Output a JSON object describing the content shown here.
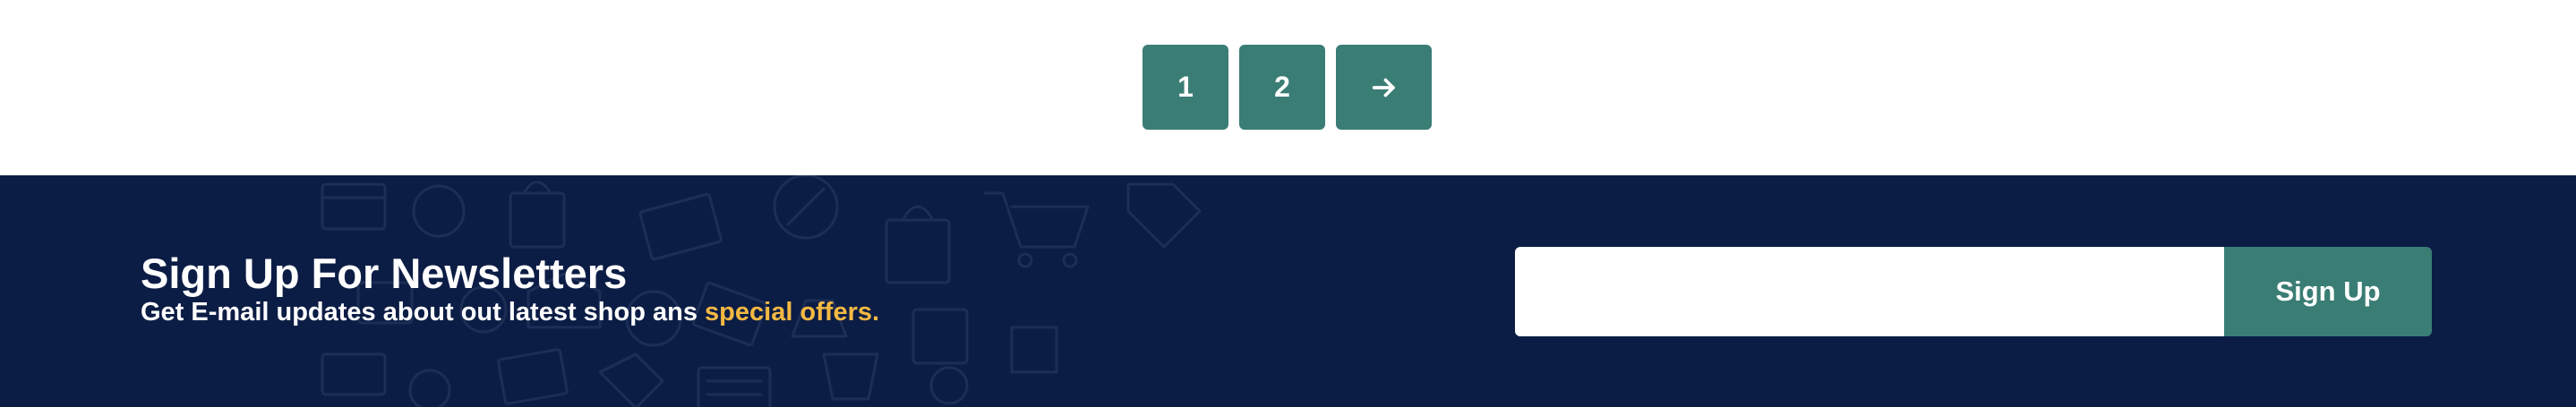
{
  "pagination": {
    "pages": [
      "1",
      "2"
    ],
    "next_icon": "arrow-right-icon"
  },
  "newsletter": {
    "title": "Sign Up For Newsletters",
    "subtitle_prefix": "Get E-mail updates about out latest shop ans ",
    "subtitle_highlight": "special offers.",
    "email_value": "",
    "email_placeholder": "",
    "signup_label": "Sign Up",
    "background_pattern": "shopping-icons-pattern"
  },
  "colors": {
    "accent": "#3a7d75",
    "footer_bg": "#0c1d45",
    "highlight": "#f5b942",
    "white": "#ffffff"
  }
}
